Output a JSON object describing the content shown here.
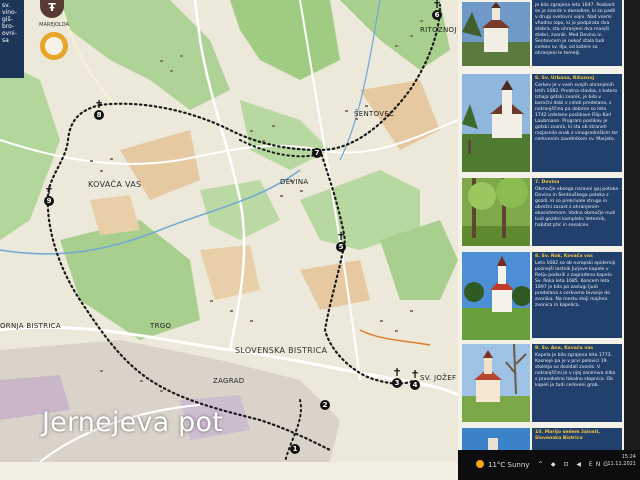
{
  "map": {
    "legend_text": "sv. vino- giš- bro- ovni- sa",
    "logo_label": "MAREJOLDA",
    "places": [
      {
        "id": "kovaca-vas",
        "text": "KOVAČA VAS"
      },
      {
        "id": "devina",
        "text": "DEVINA"
      },
      {
        "id": "sentovec",
        "text": "ŠENTOVEC"
      },
      {
        "id": "ritoznoj",
        "text": "RITOZNOJ"
      },
      {
        "id": "ornja-bistrica",
        "text": "ORNJA BISTRICA"
      },
      {
        "id": "slovenska-bistrica",
        "text": "SLOVENSKA BISTRICA"
      },
      {
        "id": "zagrad",
        "text": "ZAGRAD"
      },
      {
        "id": "sv-jozef",
        "text": "SV. JOŽEF"
      },
      {
        "id": "trgo",
        "text": "TRGO"
      }
    ],
    "markers": [
      "8",
      "9",
      "7",
      "5",
      "3",
      "2",
      "1",
      "4",
      "6"
    ]
  },
  "caption": "Jernejeva pot",
  "panel": {
    "cards": [
      {
        "head": "",
        "body": "je bila zgrajena leta 1647. Posbarit se je zvonik v donadine, ki so padli v drugi svetovni vojni. Nad vsemi vhodno lopo, ki jo podpirata dva stebra, sta ohranjeni dva manjši stebri, zvonik. Med Devino in Šentovcem je nekoč stala tudi cerkev sv. Ilja, od katere so ohranjeni le temelji."
      },
      {
        "head": "6. Sv. Urbana, Ritoznoj",
        "body": "Cerkev je v vseh svojih ohranjenih letih 1682. Prvotna stavba, s katero izhaja gotski zvonik, je bila v baročni dobi v celoti predelana, z notranjščino pa dobimo so leta 1742 izdelane poslikave Filip Karl Laubmann. Program poslikav je gotski zvonik, ki sta ob straneh razjasnila enak z vinogradniškim ter cerkvenim zavetnikom sv. Marjeto."
      },
      {
        "head": "7. Devina",
        "body": "Območje obsega naravni gaj potoka Devina in Šentovškega potoka z gozdi, ki so prekrivale strugo in obrežni zarast z ohranjenim ekosistemom. Vodno območje nudi tudi gozdni kompleks Veternik, habitat ptic in sesalcev."
      },
      {
        "head": "8. Sv. Rok, Kovača vas",
        "body": "Leta 1682 so ob evropski epidemiji poznejši lastnik Jurjeve kapele v Retju podarili z zagrađeno kapelo Sv. Roka leta 1685. Koncem leta 1897 je bila po zaslugi ljudi predelana s cerkveno bivanje do zvonika. Na mestu stoji majhna zvonica in kapelica."
      },
      {
        "head": "9. Sv. Ana, Kovača vas",
        "body": "Kapela je bila zgrajena leta 1773. Kasneje pa je v prvi polovici 19. stoletja so dozidali zvonik. V notranjščini je v njej zanimiva slika s pravokotno lokalno stopnico. Ob kapeli je tudi cerkveni grob."
      },
      {
        "head": "10. Marijo sedem žalosti, Slovenska Bistrica",
        "body": ""
      }
    ]
  },
  "taskbar": {
    "weather": "11°C  Sunny",
    "time": "15:24",
    "date": "11.11.2021",
    "tray": "^ ◆ ⊡ ◀ ENG"
  },
  "colors": {
    "map_land": "#ece8da",
    "forest": "#a9cf8e",
    "field": "#e6c9a0",
    "road": "#ffffff",
    "route": "#1a1a1a",
    "panel_text_bg": "#21406b",
    "accent": "#f4c542"
  }
}
